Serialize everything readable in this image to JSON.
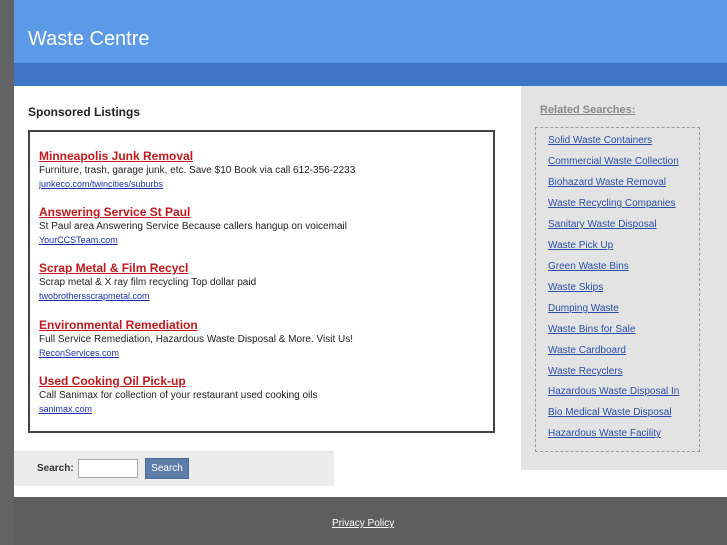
{
  "header": {
    "title": "Waste Centre"
  },
  "sponsored": {
    "title": "Sponsored Listings",
    "ads": [
      {
        "title": "Minneapolis Junk Removal",
        "description": "Furniture, trash, garage junk, etc. Save $10 Book via call 612-356-2233",
        "url": "junkeco.com/twincities/suburbs"
      },
      {
        "title": "Answering Service St Paul",
        "description": "St Paul area Answering Service Because callers hangup on voicemail",
        "url": "YourCCSTeam.com"
      },
      {
        "title": "Scrap Metal & Film Recycl",
        "description": "Scrap metal & X ray film recycling Top dollar paid",
        "url": "twobrothersscrapmetal.com"
      },
      {
        "title": "Environmental Remediation",
        "description": "Full Service Remediation, Hazardous Waste Disposal & More. Visit Us!",
        "url": "ReconServices.com"
      },
      {
        "title": "Used Cooking Oil Pick-up",
        "description": "Call Sanimax for collection of your restaurant used cooking oils",
        "url": "sanimax.com"
      }
    ]
  },
  "search": {
    "label": "Search:",
    "value": "",
    "button_label": "Search"
  },
  "related": {
    "title": "Related Searches:",
    "links": [
      "Solid Waste Containers",
      "Commercial Waste Collection",
      "Biohazard Waste Removal",
      "Waste Recycling Companies",
      "Sanitary Waste Disposal",
      "Waste Pick Up",
      "Green Waste Bins",
      "Waste Skips",
      "Dumping Waste",
      "Waste Bins for Sale",
      "Waste Cardboard",
      "Waste Recyclers",
      "Hazardous Waste Disposal In",
      "Bio Medical Waste Disposal",
      "Hazardous Waste Facility"
    ]
  },
  "footer": {
    "privacy_label": "Privacy Policy"
  },
  "colors": {
    "header": "#5c99e6",
    "header_bar": "#3f77c6",
    "ad_title": "#c2181b",
    "link": "#2a4fa8",
    "footer": "#5e5e5e"
  }
}
